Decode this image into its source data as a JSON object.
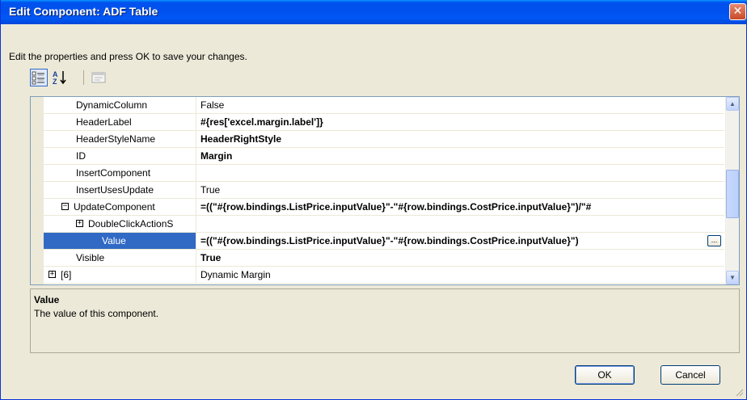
{
  "window": {
    "title": "Edit Component: ADF Table",
    "close_glyph": "✕"
  },
  "instructions": "Edit the properties and press OK to save your changes.",
  "toolbar": {
    "buttons": [
      {
        "name": "categorized-icon",
        "state": "pressed"
      },
      {
        "name": "alphabetical-sort-icon",
        "state": "normal"
      },
      {
        "name": "property-pages-icon",
        "state": "disabled"
      }
    ]
  },
  "properties": [
    {
      "name": "DynamicColumn",
      "value": "False",
      "bold": false,
      "indent": 0
    },
    {
      "name": "HeaderLabel",
      "value": "#{res['excel.margin.label']}",
      "bold": true,
      "indent": 0
    },
    {
      "name": "HeaderStyleName",
      "value": "HeaderRightStyle",
      "bold": true,
      "indent": 0
    },
    {
      "name": "ID",
      "value": "Margin",
      "bold": true,
      "indent": 0
    },
    {
      "name": "InsertComponent",
      "value": "",
      "bold": false,
      "indent": 0
    },
    {
      "name": "InsertUsesUpdate",
      "value": "True",
      "bold": false,
      "indent": 0
    },
    {
      "name": "UpdateComponent",
      "value": "=((\"#{row.bindings.ListPrice.inputValue}\"-\"#{row.bindings.CostPrice.inputValue}\")/\"#",
      "bold": true,
      "indent": 0,
      "expander": "−"
    },
    {
      "name": "DoubleClickActionS",
      "value": "",
      "bold": false,
      "indent": 1,
      "expander": "+"
    },
    {
      "name": "Value",
      "value": "=((\"#{row.bindings.ListPrice.inputValue}\"-\"#{row.bindings.CostPrice.inputValue}\")",
      "bold": true,
      "indent": 2,
      "selected": true,
      "ellipsis": "..."
    },
    {
      "name": "Visible",
      "value": "True",
      "bold": true,
      "indent": 0
    },
    {
      "name": "[6]",
      "value": "Dynamic Margin",
      "bold": false,
      "indent": -1,
      "expander": "+"
    }
  ],
  "description": {
    "title": "Value",
    "text": "The value of this component."
  },
  "buttons": {
    "ok": "OK",
    "cancel": "Cancel"
  },
  "scrollbar": {
    "up": "▲",
    "down": "▼"
  },
  "colors": {
    "title_bar": "#0054e3",
    "selection": "#316ac5",
    "dialog_bg": "#ece9d8"
  }
}
